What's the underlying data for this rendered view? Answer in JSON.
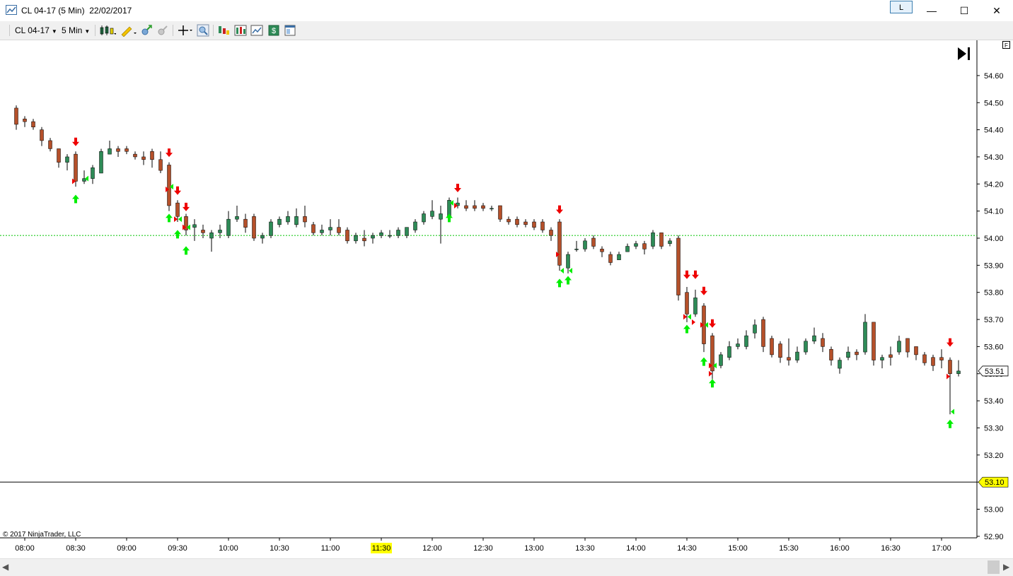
{
  "window": {
    "title": "CL 04-17 (5 Min)  22/02/2017",
    "link_button": "L",
    "minimize_glyph": "—",
    "maximize_glyph": "☐",
    "close_glyph": "✕"
  },
  "toolbar": {
    "instrument": "CL 04-17",
    "interval": "5 Min",
    "icons": [
      "bar-type-icon",
      "drawing-tools-icon",
      "zoom-in-icon",
      "zoom-out-icon",
      "crosshair-icon",
      "magnifier-icon",
      "indicators-icon",
      "strategies-icon",
      "chart-style-icon",
      "order-entry-icon",
      "properties-icon"
    ]
  },
  "chart": {
    "copyright": "© 2017 NinjaTrader, LLC",
    "f_label": "F",
    "go_to_end_glyph": "▶|",
    "price_labels": [
      "54.60",
      "54.50",
      "54.40",
      "54.30",
      "54.20",
      "54.10",
      "54.00",
      "53.90",
      "53.80",
      "53.70",
      "53.60",
      "53.50",
      "53.40",
      "53.30",
      "53.20",
      "53.10",
      "53.00",
      "52.90"
    ],
    "time_labels": [
      "08:00",
      "08:30",
      "09:00",
      "09:30",
      "10:00",
      "10:30",
      "11:00",
      "11:30",
      "12:00",
      "12:30",
      "13:00",
      "13:30",
      "14:00",
      "14:30",
      "15:00",
      "15:30",
      "16:00",
      "16:30",
      "17:00"
    ],
    "highlighted_time": "11:30",
    "last_price": "53.51",
    "horizontal_line_price": "53.10",
    "reference_line_price": 54.01,
    "colors": {
      "up_candle": "#2e8b57",
      "down_candle": "#b5502a",
      "sell_arrow": "#ee0000",
      "buy_arrow": "#00ee00",
      "highlight": "#ffff00",
      "reference_line": "#22cc22"
    }
  },
  "chart_data": {
    "type": "candlestick",
    "xlabel": "",
    "ylabel": "",
    "y_range": [
      52.88,
      54.66
    ],
    "time_range": [
      "07:55",
      "17:10"
    ],
    "candles": [
      {
        "t": "07:55",
        "o": 54.48,
        "h": 54.49,
        "l": 54.4,
        "c": 54.42
      },
      {
        "t": "08:00",
        "o": 54.44,
        "h": 54.45,
        "l": 54.41,
        "c": 54.43
      },
      {
        "t": "08:05",
        "o": 54.43,
        "h": 54.44,
        "l": 54.4,
        "c": 54.41
      },
      {
        "t": "08:10",
        "o": 54.4,
        "h": 54.41,
        "l": 54.34,
        "c": 54.36
      },
      {
        "t": "08:15",
        "o": 54.36,
        "h": 54.37,
        "l": 54.32,
        "c": 54.33
      },
      {
        "t": "08:20",
        "o": 54.33,
        "h": 54.33,
        "l": 54.26,
        "c": 54.28
      },
      {
        "t": "08:25",
        "o": 54.28,
        "h": 54.31,
        "l": 54.25,
        "c": 54.3
      },
      {
        "t": "08:30",
        "o": 54.31,
        "h": 54.32,
        "l": 54.19,
        "c": 54.21
      },
      {
        "t": "08:35",
        "o": 54.21,
        "h": 54.25,
        "l": 54.2,
        "c": 54.22
      },
      {
        "t": "08:40",
        "o": 54.22,
        "h": 54.27,
        "l": 54.2,
        "c": 54.26
      },
      {
        "t": "08:45",
        "o": 54.24,
        "h": 54.33,
        "l": 54.24,
        "c": 54.32
      },
      {
        "t": "08:50",
        "o": 54.31,
        "h": 54.36,
        "l": 54.31,
        "c": 54.33
      },
      {
        "t": "08:55",
        "o": 54.33,
        "h": 54.34,
        "l": 54.3,
        "c": 54.32
      },
      {
        "t": "09:00",
        "o": 54.33,
        "h": 54.34,
        "l": 54.31,
        "c": 54.32
      },
      {
        "t": "09:05",
        "o": 54.31,
        "h": 54.32,
        "l": 54.29,
        "c": 54.3
      },
      {
        "t": "09:10",
        "o": 54.3,
        "h": 54.32,
        "l": 54.27,
        "c": 54.29
      },
      {
        "t": "09:15",
        "o": 54.32,
        "h": 54.33,
        "l": 54.26,
        "c": 54.29
      },
      {
        "t": "09:20",
        "o": 54.29,
        "h": 54.32,
        "l": 54.24,
        "c": 54.25
      },
      {
        "t": "09:25",
        "o": 54.27,
        "h": 54.28,
        "l": 54.1,
        "c": 54.12
      },
      {
        "t": "09:30",
        "o": 54.13,
        "h": 54.14,
        "l": 54.06,
        "c": 54.08
      },
      {
        "t": "09:35",
        "o": 54.08,
        "h": 54.09,
        "l": 54.01,
        "c": 54.03
      },
      {
        "t": "09:40",
        "o": 54.04,
        "h": 54.07,
        "l": 53.99,
        "c": 54.05
      },
      {
        "t": "09:45",
        "o": 54.03,
        "h": 54.05,
        "l": 54.0,
        "c": 54.02
      },
      {
        "t": "09:50",
        "o": 54.0,
        "h": 54.03,
        "l": 53.95,
        "c": 54.02
      },
      {
        "t": "09:55",
        "o": 54.02,
        "h": 54.05,
        "l": 54.0,
        "c": 54.03
      },
      {
        "t": "10:00",
        "o": 54.01,
        "h": 54.1,
        "l": 54.0,
        "c": 54.07
      },
      {
        "t": "10:05",
        "o": 54.07,
        "h": 54.12,
        "l": 54.06,
        "c": 54.08
      },
      {
        "t": "10:10",
        "o": 54.07,
        "h": 54.09,
        "l": 54.02,
        "c": 54.04
      },
      {
        "t": "10:15",
        "o": 54.08,
        "h": 54.09,
        "l": 53.99,
        "c": 54.0
      },
      {
        "t": "10:20",
        "o": 54.0,
        "h": 54.02,
        "l": 53.98,
        "c": 54.01
      },
      {
        "t": "10:25",
        "o": 54.01,
        "h": 54.07,
        "l": 54.0,
        "c": 54.06
      },
      {
        "t": "10:30",
        "o": 54.05,
        "h": 54.08,
        "l": 54.04,
        "c": 54.07
      },
      {
        "t": "10:35",
        "o": 54.06,
        "h": 54.1,
        "l": 54.05,
        "c": 54.08
      },
      {
        "t": "10:40",
        "o": 54.05,
        "h": 54.11,
        "l": 54.04,
        "c": 54.08
      },
      {
        "t": "10:45",
        "o": 54.08,
        "h": 54.12,
        "l": 54.04,
        "c": 54.06
      },
      {
        "t": "10:50",
        "o": 54.05,
        "h": 54.06,
        "l": 54.01,
        "c": 54.02
      },
      {
        "t": "10:55",
        "o": 54.02,
        "h": 54.05,
        "l": 54.01,
        "c": 54.03
      },
      {
        "t": "11:00",
        "o": 54.03,
        "h": 54.07,
        "l": 54.01,
        "c": 54.04
      },
      {
        "t": "11:05",
        "o": 54.04,
        "h": 54.07,
        "l": 54.01,
        "c": 54.02
      },
      {
        "t": "11:10",
        "o": 54.03,
        "h": 54.04,
        "l": 53.98,
        "c": 53.99
      },
      {
        "t": "11:15",
        "o": 53.99,
        "h": 54.02,
        "l": 53.98,
        "c": 54.01
      },
      {
        "t": "11:20",
        "o": 54.0,
        "h": 54.03,
        "l": 53.97,
        "c": 53.99
      },
      {
        "t": "11:25",
        "o": 54.0,
        "h": 54.02,
        "l": 53.98,
        "c": 54.01
      },
      {
        "t": "11:30",
        "o": 54.01,
        "h": 54.03,
        "l": 54.0,
        "c": 54.02
      },
      {
        "t": "11:35",
        "o": 54.01,
        "h": 54.03,
        "l": 54.0,
        "c": 54.01
      },
      {
        "t": "11:40",
        "o": 54.01,
        "h": 54.04,
        "l": 54.0,
        "c": 54.03
      },
      {
        "t": "11:45",
        "o": 54.01,
        "h": 54.04,
        "l": 54.0,
        "c": 54.04
      },
      {
        "t": "11:50",
        "o": 54.03,
        "h": 54.07,
        "l": 54.02,
        "c": 54.06
      },
      {
        "t": "11:55",
        "o": 54.06,
        "h": 54.1,
        "l": 54.05,
        "c": 54.09
      },
      {
        "t": "12:00",
        "o": 54.08,
        "h": 54.14,
        "l": 54.07,
        "c": 54.1
      },
      {
        "t": "12:05",
        "o": 54.07,
        "h": 54.12,
        "l": 53.98,
        "c": 54.09
      },
      {
        "t": "12:10",
        "o": 54.08,
        "h": 54.15,
        "l": 54.07,
        "c": 54.14
      },
      {
        "t": "12:15",
        "o": 54.12,
        "h": 54.15,
        "l": 54.11,
        "c": 54.13
      },
      {
        "t": "12:20",
        "o": 54.12,
        "h": 54.14,
        "l": 54.1,
        "c": 54.11
      },
      {
        "t": "12:25",
        "o": 54.12,
        "h": 54.14,
        "l": 54.1,
        "c": 54.11
      },
      {
        "t": "12:30",
        "o": 54.12,
        "h": 54.13,
        "l": 54.1,
        "c": 54.11
      },
      {
        "t": "12:35",
        "o": 54.11,
        "h": 54.12,
        "l": 54.1,
        "c": 54.11
      },
      {
        "t": "12:40",
        "o": 54.12,
        "h": 54.12,
        "l": 54.06,
        "c": 54.07
      },
      {
        "t": "12:45",
        "o": 54.07,
        "h": 54.08,
        "l": 54.05,
        "c": 54.06
      },
      {
        "t": "12:50",
        "o": 54.07,
        "h": 54.08,
        "l": 54.04,
        "c": 54.05
      },
      {
        "t": "12:55",
        "o": 54.06,
        "h": 54.07,
        "l": 54.04,
        "c": 54.05
      },
      {
        "t": "13:00",
        "o": 54.06,
        "h": 54.07,
        "l": 54.03,
        "c": 54.04
      },
      {
        "t": "13:05",
        "o": 54.06,
        "h": 54.07,
        "l": 54.02,
        "c": 54.03
      },
      {
        "t": "13:10",
        "o": 54.03,
        "h": 54.04,
        "l": 53.99,
        "c": 54.01
      },
      {
        "t": "13:15",
        "o": 54.06,
        "h": 54.07,
        "l": 53.88,
        "c": 53.9
      },
      {
        "t": "13:20",
        "o": 53.89,
        "h": 53.95,
        "l": 53.87,
        "c": 53.94
      },
      {
        "t": "13:25",
        "o": 53.96,
        "h": 53.99,
        "l": 53.95,
        "c": 53.96
      },
      {
        "t": "13:30",
        "o": 53.96,
        "h": 54.0,
        "l": 53.95,
        "c": 53.99
      },
      {
        "t": "13:35",
        "o": 54.0,
        "h": 54.01,
        "l": 53.96,
        "c": 53.97
      },
      {
        "t": "13:40",
        "o": 53.96,
        "h": 53.97,
        "l": 53.93,
        "c": 53.95
      },
      {
        "t": "13:45",
        "o": 53.94,
        "h": 53.95,
        "l": 53.9,
        "c": 53.91
      },
      {
        "t": "13:50",
        "o": 53.92,
        "h": 53.95,
        "l": 53.92,
        "c": 53.94
      },
      {
        "t": "13:55",
        "o": 53.95,
        "h": 53.98,
        "l": 53.95,
        "c": 53.97
      },
      {
        "t": "14:00",
        "o": 53.97,
        "h": 53.99,
        "l": 53.96,
        "c": 53.98
      },
      {
        "t": "14:05",
        "o": 53.98,
        "h": 53.99,
        "l": 53.94,
        "c": 53.96
      },
      {
        "t": "14:10",
        "o": 53.97,
        "h": 54.03,
        "l": 53.96,
        "c": 54.02
      },
      {
        "t": "14:15",
        "o": 54.02,
        "h": 54.02,
        "l": 53.96,
        "c": 53.97
      },
      {
        "t": "14:20",
        "o": 53.98,
        "h": 54.0,
        "l": 53.97,
        "c": 53.99
      },
      {
        "t": "14:25",
        "o": 54.0,
        "h": 54.01,
        "l": 53.77,
        "c": 53.79
      },
      {
        "t": "14:30",
        "o": 53.8,
        "h": 53.82,
        "l": 53.69,
        "c": 53.72
      },
      {
        "t": "14:35",
        "o": 53.72,
        "h": 53.81,
        "l": 53.71,
        "c": 53.78
      },
      {
        "t": "14:40",
        "o": 53.75,
        "h": 53.76,
        "l": 53.58,
        "c": 53.61
      },
      {
        "t": "14:45",
        "o": 53.64,
        "h": 53.65,
        "l": 53.48,
        "c": 53.51
      },
      {
        "t": "14:50",
        "o": 53.53,
        "h": 53.58,
        "l": 53.52,
        "c": 53.57
      },
      {
        "t": "14:55",
        "o": 53.56,
        "h": 53.62,
        "l": 53.55,
        "c": 53.6
      },
      {
        "t": "15:00",
        "o": 53.6,
        "h": 53.63,
        "l": 53.59,
        "c": 53.61
      },
      {
        "t": "15:05",
        "o": 53.6,
        "h": 53.66,
        "l": 53.59,
        "c": 53.64
      },
      {
        "t": "15:10",
        "o": 53.65,
        "h": 53.7,
        "l": 53.63,
        "c": 53.68
      },
      {
        "t": "15:15",
        "o": 53.7,
        "h": 53.71,
        "l": 53.58,
        "c": 53.6
      },
      {
        "t": "15:20",
        "o": 53.63,
        "h": 53.64,
        "l": 53.56,
        "c": 53.57
      },
      {
        "t": "15:25",
        "o": 53.61,
        "h": 53.62,
        "l": 53.54,
        "c": 53.56
      },
      {
        "t": "15:30",
        "o": 53.56,
        "h": 53.63,
        "l": 53.53,
        "c": 53.55
      },
      {
        "t": "15:35",
        "o": 53.55,
        "h": 53.6,
        "l": 53.54,
        "c": 53.58
      },
      {
        "t": "15:40",
        "o": 53.58,
        "h": 53.63,
        "l": 53.57,
        "c": 53.62
      },
      {
        "t": "15:45",
        "o": 53.62,
        "h": 53.67,
        "l": 53.61,
        "c": 53.64
      },
      {
        "t": "15:50",
        "o": 53.63,
        "h": 53.65,
        "l": 53.58,
        "c": 53.6
      },
      {
        "t": "15:55",
        "o": 53.59,
        "h": 53.6,
        "l": 53.53,
        "c": 53.55
      },
      {
        "t": "16:00",
        "o": 53.52,
        "h": 53.56,
        "l": 53.5,
        "c": 53.55
      },
      {
        "t": "16:05",
        "o": 53.56,
        "h": 53.6,
        "l": 53.55,
        "c": 53.58
      },
      {
        "t": "16:10",
        "o": 53.58,
        "h": 53.59,
        "l": 53.55,
        "c": 53.57
      },
      {
        "t": "16:15",
        "o": 53.58,
        "h": 53.72,
        "l": 53.57,
        "c": 53.69
      },
      {
        "t": "16:20",
        "o": 53.69,
        "h": 53.69,
        "l": 53.53,
        "c": 53.55
      },
      {
        "t": "16:25",
        "o": 53.55,
        "h": 53.57,
        "l": 53.52,
        "c": 53.56
      },
      {
        "t": "16:30",
        "o": 53.57,
        "h": 53.6,
        "l": 53.53,
        "c": 53.56
      },
      {
        "t": "16:35",
        "o": 53.58,
        "h": 53.64,
        "l": 53.57,
        "c": 53.62
      },
      {
        "t": "16:40",
        "o": 53.63,
        "h": 53.63,
        "l": 53.56,
        "c": 53.58
      },
      {
        "t": "16:45",
        "o": 53.6,
        "h": 53.6,
        "l": 53.55,
        "c": 53.57
      },
      {
        "t": "16:50",
        "o": 53.57,
        "h": 53.58,
        "l": 53.53,
        "c": 53.54
      },
      {
        "t": "16:55",
        "o": 53.56,
        "h": 53.57,
        "l": 53.51,
        "c": 53.53
      },
      {
        "t": "17:00",
        "o": 53.56,
        "h": 53.59,
        "l": 53.52,
        "c": 53.55
      },
      {
        "t": "17:05",
        "o": 53.55,
        "h": 53.56,
        "l": 53.35,
        "c": 53.5
      },
      {
        "t": "17:10",
        "o": 53.5,
        "h": 53.55,
        "l": 53.49,
        "c": 53.51
      }
    ],
    "sell_signals": [
      {
        "t": "08:30",
        "p": 54.35
      },
      {
        "t": "09:25",
        "p": 54.31
      },
      {
        "t": "09:30",
        "p": 54.17
      },
      {
        "t": "09:35",
        "p": 54.11
      },
      {
        "t": "12:15",
        "p": 54.18
      },
      {
        "t": "13:15",
        "p": 54.1
      },
      {
        "t": "14:30",
        "p": 53.86
      },
      {
        "t": "14:35",
        "p": 53.86
      },
      {
        "t": "14:40",
        "p": 53.8
      },
      {
        "t": "14:45",
        "p": 53.68
      },
      {
        "t": "17:05",
        "p": 53.61
      }
    ],
    "buy_signals": [
      {
        "t": "08:30",
        "p": 54.15
      },
      {
        "t": "09:25",
        "p": 54.08
      },
      {
        "t": "09:30",
        "p": 54.02
      },
      {
        "t": "09:35",
        "p": 53.96
      },
      {
        "t": "12:10",
        "p": 54.08
      },
      {
        "t": "13:15",
        "p": 53.84
      },
      {
        "t": "13:20",
        "p": 53.85
      },
      {
        "t": "14:30",
        "p": 53.67
      },
      {
        "t": "14:40",
        "p": 53.55
      },
      {
        "t": "14:45",
        "p": 53.47
      },
      {
        "t": "17:05",
        "p": 53.32
      }
    ],
    "entry_marks": [
      {
        "t": "08:30",
        "p": 54.21,
        "side": "sell"
      },
      {
        "t": "08:35",
        "p": 54.22,
        "side": "buy"
      },
      {
        "t": "09:25",
        "p": 54.18,
        "side": "sell"
      },
      {
        "t": "09:25",
        "p": 54.19,
        "side": "buy"
      },
      {
        "t": "09:30",
        "p": 54.07,
        "side": "sell"
      },
      {
        "t": "09:30",
        "p": 54.07,
        "side": "buy"
      },
      {
        "t": "09:35",
        "p": 54.04,
        "side": "sell"
      },
      {
        "t": "09:35",
        "p": 54.04,
        "side": "buy"
      },
      {
        "t": "12:10",
        "p": 54.13,
        "side": "buy"
      },
      {
        "t": "12:15",
        "p": 54.12,
        "side": "sell"
      },
      {
        "t": "13:15",
        "p": 53.94,
        "side": "sell"
      },
      {
        "t": "13:15",
        "p": 53.88,
        "side": "buy"
      },
      {
        "t": "13:20",
        "p": 53.88,
        "side": "buy"
      },
      {
        "t": "14:30",
        "p": 53.71,
        "side": "sell"
      },
      {
        "t": "14:30",
        "p": 53.71,
        "side": "buy"
      },
      {
        "t": "14:35",
        "p": 53.69,
        "side": "sell"
      },
      {
        "t": "14:40",
        "p": 53.68,
        "side": "sell"
      },
      {
        "t": "14:40",
        "p": 53.68,
        "side": "buy"
      },
      {
        "t": "14:45",
        "p": 53.53,
        "side": "sell"
      },
      {
        "t": "14:45",
        "p": 53.53,
        "side": "buy"
      },
      {
        "t": "14:45",
        "p": 53.5,
        "side": "sell"
      },
      {
        "t": "17:05",
        "p": 53.49,
        "side": "sell"
      },
      {
        "t": "17:05",
        "p": 53.36,
        "side": "buy"
      }
    ]
  }
}
